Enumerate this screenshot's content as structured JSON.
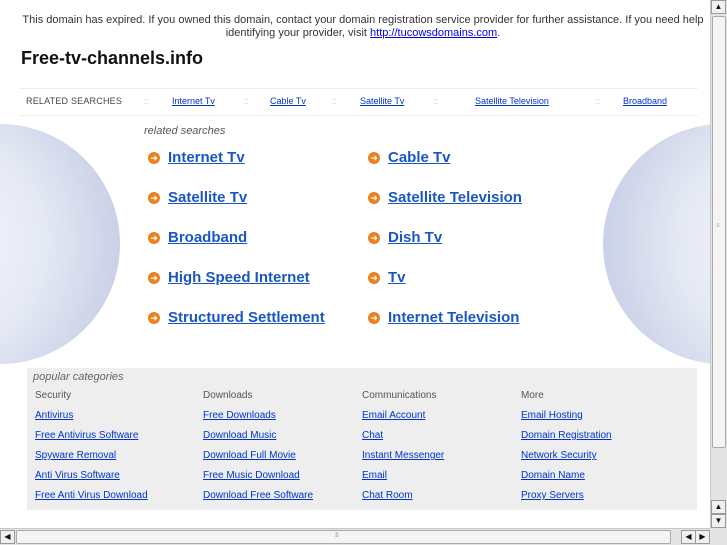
{
  "notice": {
    "text_before": "This domain has expired. If you owned this domain, contact your domain registration service provider for further assistance. If you need help identifying your provider, visit ",
    "link": "http://tucowsdomains.com",
    "text_after": "."
  },
  "site_title": "Free-tv-channels.info",
  "related_bar": {
    "label": "RELATED SEARCHES",
    "separator": "::",
    "links": [
      "Internet Tv",
      "Cable Tv",
      "Satellite Tv",
      "Satellite Television",
      "Broadband"
    ]
  },
  "related_searches": {
    "heading": "related searches",
    "arrow_glyph": "➜",
    "left": [
      "Internet Tv",
      "Satellite Tv",
      "Broadband",
      "High Speed Internet",
      "Structured Settlement"
    ],
    "right": [
      "Cable Tv",
      "Satellite Television",
      "Dish Tv",
      "Tv",
      "Internet Television"
    ]
  },
  "popular_categories": {
    "heading": "popular categories",
    "columns": [
      {
        "title": "Security",
        "links": [
          "Antivirus",
          "Free Antivirus Software",
          "Spyware Removal",
          "Anti Virus Software",
          "Free Anti Virus Download"
        ]
      },
      {
        "title": "Downloads",
        "links": [
          "Free Downloads",
          "Download Music",
          "Download Full Movie",
          "Free Music Download",
          "Download Free Software"
        ]
      },
      {
        "title": "Communications",
        "links": [
          "Email Account",
          "Chat",
          "Instant Messenger",
          "Email",
          "Chat Room"
        ]
      },
      {
        "title": "More",
        "links": [
          "Email Hosting",
          "Domain Registration",
          "Network Security",
          "Domain Name",
          "Proxy Servers"
        ]
      }
    ]
  },
  "colors": {
    "link": "#1a56c4",
    "arrow": "#e8821e",
    "popular_bg": "#eeeeee"
  }
}
